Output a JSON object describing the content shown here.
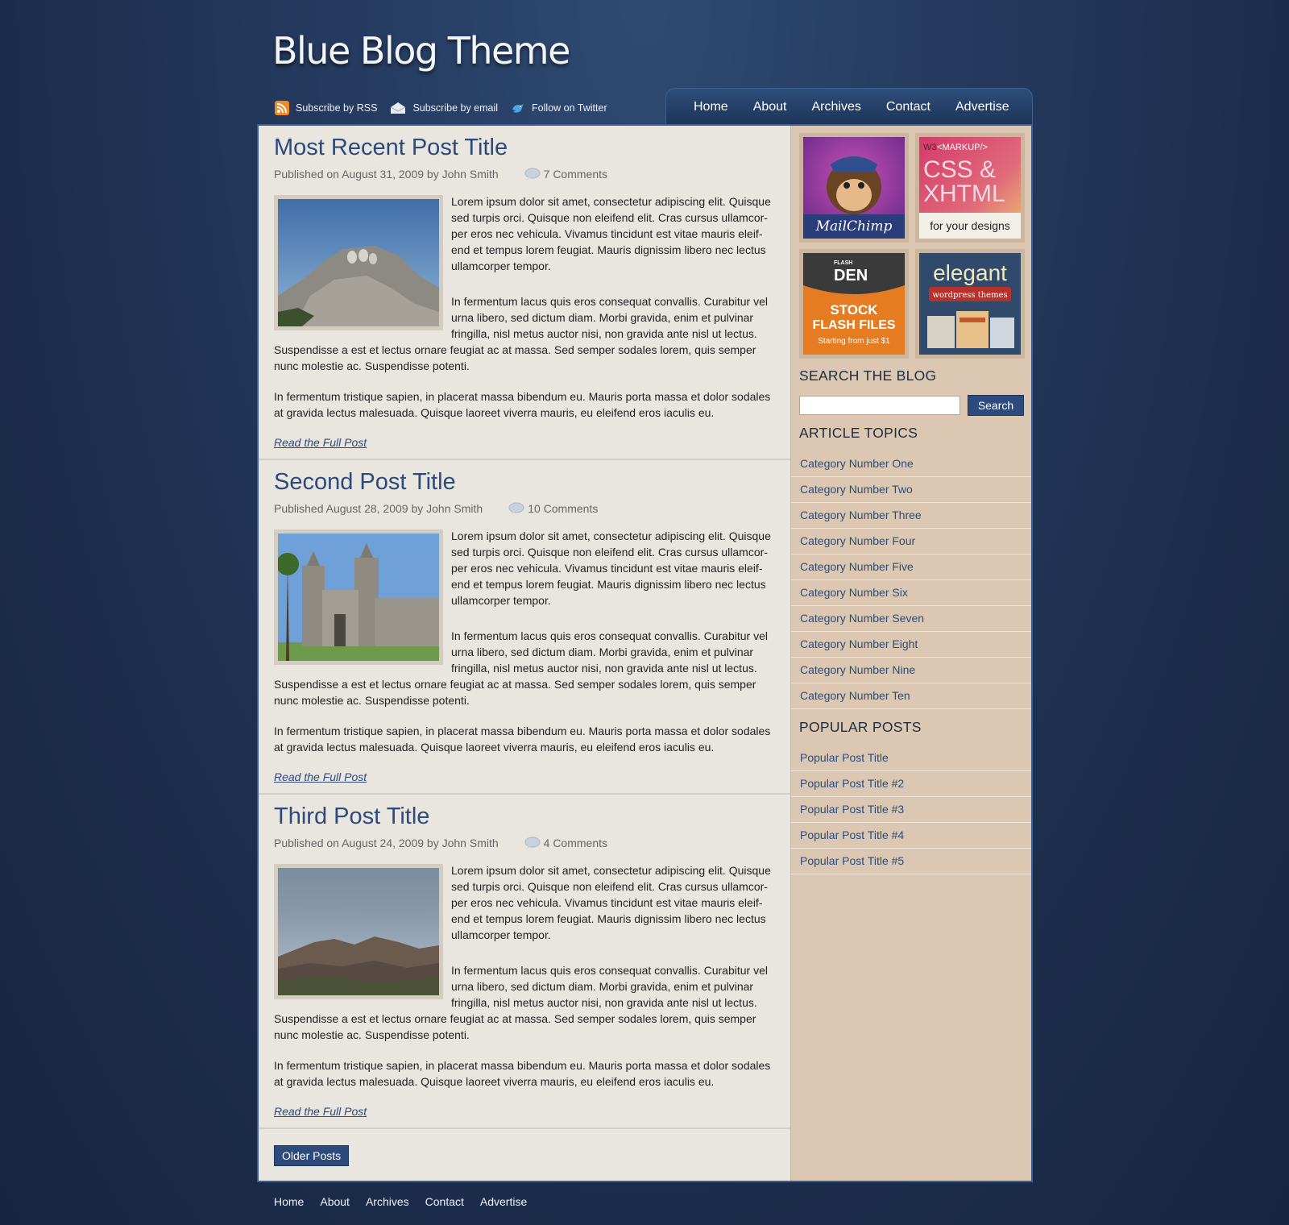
{
  "site": {
    "title": "Blue Blog Theme"
  },
  "subscribe": [
    {
      "label": "Subscribe by RSS",
      "icon": "rss-icon"
    },
    {
      "label": "Subscribe by email",
      "icon": "email-icon"
    },
    {
      "label": "Follow on Twitter",
      "icon": "twitter-bird-icon"
    }
  ],
  "nav": [
    "Home",
    "About",
    "Archives",
    "Contact",
    "Advertise"
  ],
  "posts": [
    {
      "title": "Most Recent Post Title",
      "meta": "Published on August 31, 2009 by John Smith",
      "comments": "7 Comments",
      "image": "mount-rushmore-photo",
      "para1": "Lorem ipsum dolor sit amet, consectetur adipiscing elit. Quisque sed turpis orci. Quisque non eleifend elit. Cras cursus ullamcor- per eros nec vehicula. Vivamus tincidunt est vitae mauris eleif- end et tempus lorem feugiat. Mauris dignissim libero nec lectus ullamcorper tempor.",
      "para2a": "In fermentum lacus quis eros consequat convallis. Curabitur vel urna libero, sed dictum diam. Morbi gravida, enim et pulvinar fringilla, nisl metus auctor nisi, non gravida ante nisl ut lectus.",
      "para2b": "Suspendisse a est et lectus ornare feugiat ac at massa. Sed semper sodales lorem, quis semper nunc molestie ac. Suspendisse potenti.",
      "para3": "In fermentum tristique sapien, in placerat massa bibendum eu. Mauris porta massa et dolor sodales at gravida lectus malesuada. Quisque laoreet viverra mauris, eu eleifend eros iaculis eu.",
      "read_more": "Read the Full Post"
    },
    {
      "title": "Second Post Title",
      "meta": "Published August 28, 2009 by John Smith",
      "comments": "10 Comments",
      "image": "mission-church-photo",
      "para1": "Lorem ipsum dolor sit amet, consectetur adipiscing elit. Quisque sed turpis orci. Quisque non eleifend elit. Cras cursus ullamcor- per eros nec vehicula. Vivamus tincidunt est vitae mauris eleif- end et tempus lorem feugiat. Mauris dignissim libero nec lectus ullamcorper tempor.",
      "para2a": "In fermentum lacus quis eros consequat convallis. Curabitur vel urna libero, sed dictum diam. Morbi gravida, enim et pulvinar fringilla, nisl metus auctor nisi, non gravida ante nisl ut lectus.",
      "para2b": "Suspendisse a est et lectus ornare feugiat ac at massa. Sed semper sodales lorem, quis semper nunc molestie ac. Suspendisse potenti.",
      "para3": "In fermentum tristique sapien, in placerat massa bibendum eu. Mauris porta massa et dolor sodales at gravida lectus malesuada. Quisque laoreet viverra mauris, eu eleifend eros iaculis eu.",
      "read_more": "Read the Full Post"
    },
    {
      "title": "Third Post Title",
      "meta": "Published on August 24, 2009 by John Smith",
      "comments": "4 Comments",
      "image": "badlands-photo",
      "para1": "Lorem ipsum dolor sit amet, consectetur adipiscing elit. Quisque sed turpis orci. Quisque non eleifend elit. Cras cursus ullamcor- per eros nec vehicula. Vivamus tincidunt est vitae mauris eleif- end et tempus lorem feugiat. Mauris dignissim libero nec lectus ullamcorper tempor.",
      "para2a": "In fermentum lacus quis eros consequat convallis. Curabitur vel urna libero, sed dictum diam. Morbi gravida, enim et pulvinar fringilla, nisl metus auctor nisi, non gravida ante nisl ut lectus.",
      "para2b": "Suspendisse a est et lectus ornare feugiat ac at massa. Sed semper sodales lorem, quis semper nunc molestie ac. Suspendisse potenti.",
      "para3": "In fermentum tristique sapien, in placerat massa bibendum eu. Mauris porta massa et dolor sodales at gravida lectus malesuada. Quisque laoreet viverra mauris, eu eleifend eros iaculis eu.",
      "read_more": "Read the Full Post"
    }
  ],
  "older_posts": "Older Posts",
  "ads": {
    "mailchimp": {
      "text": "MailChimp"
    },
    "markup": {
      "w3": "W3",
      "tag": "<MARKUP/>",
      "line1": "CSS &",
      "line2": "XHTML",
      "sub": "for your designs"
    },
    "flashden": {
      "small": "FLASH",
      "logo": "DEN",
      "line1": "STOCK",
      "line2": "FLASH FILES",
      "sub": "Starting from just $1"
    },
    "elegant": {
      "logo": "elegant",
      "sub": "wordpress themes"
    }
  },
  "sidebar": {
    "search_heading": "SEARCH THE BLOG",
    "search_placeholder": "",
    "search_button": "Search",
    "topics_heading": "ARTICLE TOPICS",
    "topics": [
      "Category Number One",
      "Category Number Two",
      "Category Number Three",
      "Category Number Four",
      "Category Number Five",
      "Category Number Six",
      "Category Number Seven",
      "Category Number Eight",
      "Category Number Nine",
      "Category Number Ten"
    ],
    "popular_heading": "POPULAR POSTS",
    "popular": [
      "Popular Post Title",
      "Popular Post Title #2",
      "Popular Post Title #3",
      "Popular Post Title #4",
      "Popular Post Title #5"
    ]
  },
  "footer_nav": [
    "Home",
    "About",
    "Archives",
    "Contact",
    "Advertise"
  ],
  "colors": {
    "link": "#2c4a7c",
    "background": "#1c2d4b",
    "sidebar": "#dcc8b2",
    "content": "#e9e5df"
  }
}
